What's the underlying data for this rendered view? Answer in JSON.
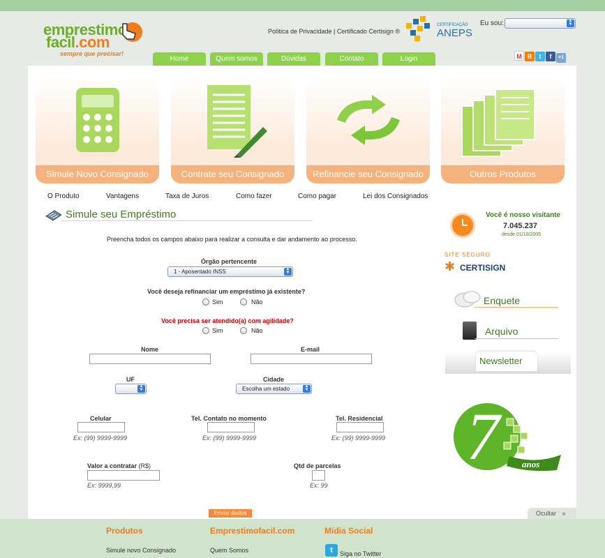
{
  "header": {
    "logo_line1": "emprestimo",
    "logo_line2": "facil",
    "logo_suffix": ".com",
    "tagline": "sempre que precisar!",
    "top_links": "Política de Privacidade | Certificado Certisign ®",
    "aneps_small": "CERTIFICAÇÃO",
    "aneps_big": "ANEPS",
    "eu_sou_label": "Eu sou:",
    "eu_sou_value": ""
  },
  "nav": {
    "items": [
      "Home",
      "Quem somos",
      "Dúvidas",
      "Contato",
      "Login"
    ]
  },
  "social": {
    "icons": [
      "gmail-icon",
      "blogger-icon",
      "twitter-icon",
      "facebook-icon",
      "google-plus-icon"
    ]
  },
  "tiles": [
    {
      "label": "Simule Novo Consignado",
      "icon": "calculator-icon"
    },
    {
      "label": "Contrate seu Consignado",
      "icon": "document-pen-icon"
    },
    {
      "label": "Refinancie seu Consignado",
      "icon": "refresh-arrows-icon"
    },
    {
      "label": "Outros Produtos",
      "icon": "stacked-documents-icon"
    }
  ],
  "subnav": [
    "O Produto",
    "Vantagens",
    "Taxa de Juros",
    "Como fazer",
    "Como pagar",
    "Lei dos Consignados"
  ],
  "form": {
    "title": "Simule seu Empréstimo",
    "intro": "Preencha todos os campos abaixo para realizar a consulta e dar andamento ao processo.",
    "orgao_label": "Órgão pertencente",
    "orgao_value": "1 - Aposentado INSS",
    "refinanciar_q": "Você deseja refinanciar um empréstimo já existente?",
    "agilidade_q": "Você precisa ser atendido(a) com agilidade?",
    "sim": "Sim",
    "nao": "Não",
    "nome_label": "Nome",
    "email_label": "E-mail",
    "uf_label": "UF",
    "cidade_label": "Cidade",
    "cidade_value": "Escolha um estado",
    "celular_label": "Celular",
    "tel_momento_label": "Tel. Contato no momento",
    "tel_res_label": "Tel. Residencial",
    "phone_hint": "Ex: (99) 9999-9999",
    "valor_label": "Valor a contratar",
    "valor_unit": "(R$)",
    "valor_hint": "Ex: 9999,99",
    "parcelas_label": "Qtd de parcelas",
    "parcelas_hint": "Ex: 99",
    "submit": "Enviar dados"
  },
  "sidebar": {
    "visit_title": "Você é nosso visitante",
    "visit_count": "7.045.237",
    "visit_since": "desde 01/10/2005",
    "secure_top": "SITE SEGURO",
    "secure_brand": "CERTISIGN",
    "enquete": "Enquete",
    "arquivo": "Arquivo",
    "newsletter": "Newsletter",
    "anos_number": "7",
    "anos_text": "anos"
  },
  "ocultar": "Ocultar",
  "footer": {
    "col1_head": "Produtos",
    "col1_link": "Simule novo Consignado",
    "col2_head": "Emprestimofacil.com",
    "col2_link": "Quem Somos",
    "col3_head": "Mídia Social",
    "col3_link": "Siga no Twitter"
  }
}
